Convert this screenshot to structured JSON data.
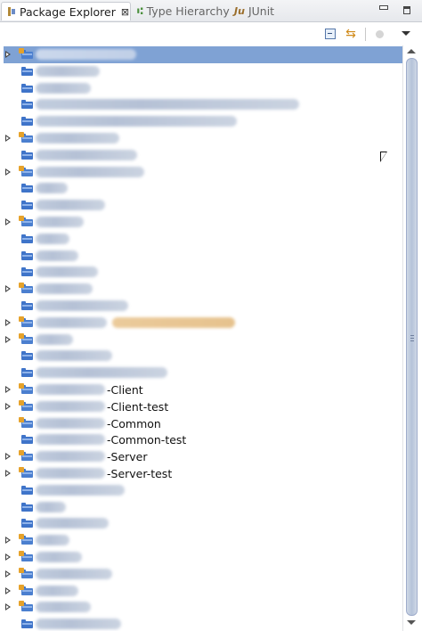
{
  "tabs": [
    {
      "label": "Package Explorer",
      "icon": "package-explorer-icon",
      "active": true,
      "close": "⊠"
    },
    {
      "label": "Type Hierarchy",
      "icon": "type-hierarchy-icon",
      "active": false
    },
    {
      "label": "JUnit",
      "icon": "junit-icon",
      "active": false
    }
  ],
  "toolbar": {
    "buttons": [
      "collapse-all-icon",
      "link-with-editor-icon",
      "focus-icon",
      "view-menu-icon"
    ]
  },
  "tree": {
    "rows": [
      {
        "expandable": true,
        "icon": "project-icon",
        "selected": true,
        "blur_width": 113
      },
      {
        "expandable": false,
        "icon": "folder-icon",
        "blur_width": 72
      },
      {
        "expandable": false,
        "icon": "folder-icon",
        "blur_width": 62
      },
      {
        "expandable": false,
        "icon": "folder-icon",
        "blur_width": 296
      },
      {
        "expandable": false,
        "icon": "folder-icon",
        "blur_width": 226
      },
      {
        "expandable": true,
        "icon": "project-icon",
        "blur_width": 94
      },
      {
        "expandable": false,
        "icon": "folder-icon",
        "blur_width": 114
      },
      {
        "expandable": true,
        "icon": "project-icon",
        "blur_width": 122
      },
      {
        "expandable": false,
        "icon": "folder-icon",
        "blur_width": 36
      },
      {
        "expandable": false,
        "icon": "folder-icon",
        "blur_width": 78
      },
      {
        "expandable": true,
        "icon": "project-icon",
        "blur_width": 54
      },
      {
        "expandable": false,
        "icon": "folder-icon",
        "blur_width": 38
      },
      {
        "expandable": false,
        "icon": "folder-icon",
        "blur_width": 48
      },
      {
        "expandable": false,
        "icon": "folder-icon",
        "blur_width": 70
      },
      {
        "expandable": true,
        "icon": "project-icon",
        "blur_width": 64
      },
      {
        "expandable": false,
        "icon": "folder-icon",
        "blur_width": 104
      },
      {
        "expandable": true,
        "icon": "server-project-icon",
        "blur_width": 80,
        "extra_blur_width": 138
      },
      {
        "expandable": true,
        "icon": "project-icon",
        "blur_width": 42
      },
      {
        "expandable": false,
        "icon": "folder-icon",
        "blur_width": 86
      },
      {
        "expandable": false,
        "icon": "folder-icon",
        "blur_width": 148
      },
      {
        "expandable": true,
        "icon": "project-icon",
        "blur_width": 78,
        "suffix": "-Client"
      },
      {
        "expandable": true,
        "icon": "project-icon",
        "blur_width": 78,
        "suffix": "-Client-test"
      },
      {
        "expandable": false,
        "icon": "project-icon",
        "blur_width": 78,
        "suffix": "-Common"
      },
      {
        "expandable": false,
        "icon": "folder-icon",
        "blur_width": 78,
        "suffix": "-Common-test"
      },
      {
        "expandable": true,
        "icon": "project-icon",
        "blur_width": 78,
        "suffix": "-Server"
      },
      {
        "expandable": true,
        "icon": "project-icon",
        "blur_width": 78,
        "suffix": "-Server-test"
      },
      {
        "expandable": false,
        "icon": "folder-icon",
        "blur_width": 100
      },
      {
        "expandable": false,
        "icon": "folder-icon",
        "blur_width": 34
      },
      {
        "expandable": false,
        "icon": "folder-icon",
        "blur_width": 82
      },
      {
        "expandable": true,
        "icon": "project-icon",
        "blur_width": 38
      },
      {
        "expandable": true,
        "icon": "project-icon",
        "blur_width": 52
      },
      {
        "expandable": true,
        "icon": "project-icon",
        "blur_width": 86
      },
      {
        "expandable": true,
        "icon": "project-icon",
        "blur_width": 48
      },
      {
        "expandable": true,
        "icon": "project-icon",
        "blur_width": 62
      },
      {
        "expandable": false,
        "icon": "folder-icon",
        "blur_width": 96
      }
    ]
  },
  "scrollbar": {
    "position": 0.0,
    "visible_fraction": 0.95
  }
}
